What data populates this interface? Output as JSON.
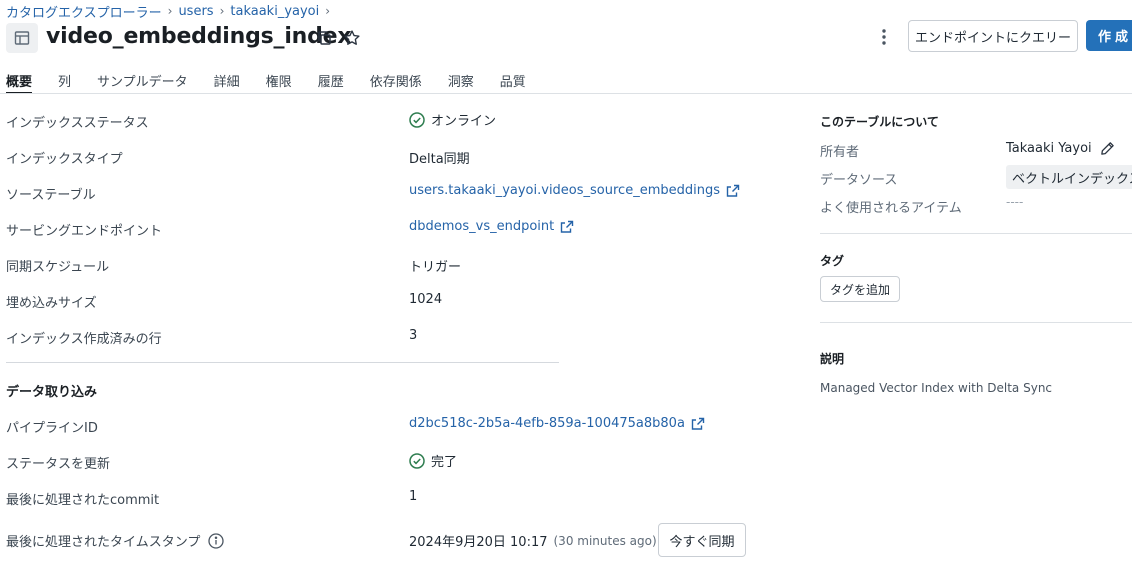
{
  "breadcrumb": {
    "items": [
      "カタログエクスプローラー",
      "users",
      "takaaki_yayoi"
    ],
    "separator": "›"
  },
  "header": {
    "title": "video_embeddings_index",
    "query_button": "エンドポイントにクエリー",
    "create_button": "作成"
  },
  "tabs": [
    "概要",
    "列",
    "サンプルデータ",
    "詳細",
    "権限",
    "履歴",
    "依存関係",
    "洞察",
    "品質"
  ],
  "overview": {
    "index_status_label": "インデックスステータス",
    "index_status_value": "オンライン",
    "index_type_label": "インデックスタイプ",
    "index_type_value": "Delta同期",
    "source_table_label": "ソーステーブル",
    "source_table_value": "users.takaaki_yayoi.videos_source_embeddings",
    "serving_endpoint_label": "サービングエンドポイント",
    "serving_endpoint_value": "dbdemos_vs_endpoint",
    "sync_schedule_label": "同期スケジュール",
    "sync_schedule_value": "トリガー",
    "embedding_size_label": "埋め込みサイズ",
    "embedding_size_value": "1024",
    "indexed_rows_label": "インデックス作成済みの行",
    "indexed_rows_value": "3"
  },
  "ingestion": {
    "section_title": "データ取り込み",
    "pipeline_id_label": "パイプラインID",
    "pipeline_id_value": "d2bc518c-2b5a-4efb-859a-100475a8b80a",
    "update_status_label": "ステータスを更新",
    "update_status_value": "完了",
    "last_commit_label": "最後に処理されたcommit",
    "last_commit_value": "1",
    "last_timestamp_label": "最後に処理されたタイムスタンプ",
    "last_timestamp_value": "2024年9月20日 10:17",
    "last_timestamp_relative": "(30 minutes ago)",
    "sync_now_button": "今すぐ同期"
  },
  "about": {
    "title": "このテーブルについて",
    "owner_label": "所有者",
    "owner_value": "Takaaki Yayoi",
    "data_source_label": "データソース",
    "data_source_value": "ベクトルインデックス",
    "frequently_used_label": "よく使用されるアイテム",
    "frequently_used_value": "----"
  },
  "tags": {
    "title": "タグ",
    "add_button": "タグを追加"
  },
  "description": {
    "title": "説明",
    "text": "Managed Vector Index with Delta Sync"
  },
  "colors": {
    "link": "#2563a8",
    "primary": "#2471b9",
    "success": "#2e7d4f"
  }
}
